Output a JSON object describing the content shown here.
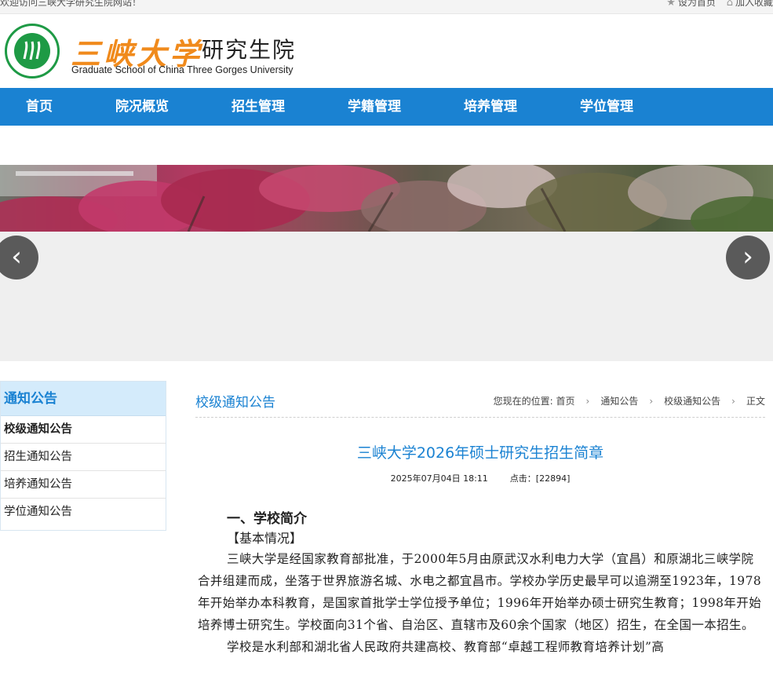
{
  "topbar": {
    "welcome": "欢迎访问三峡大学研究生院网站！",
    "set_home": "设为首页",
    "add_favorite": "加入收藏"
  },
  "header": {
    "brand_cn": "三峡大学",
    "school_cn": "研究生院",
    "school_en": "Graduate School of China Three Gorges University"
  },
  "nav": {
    "items": [
      {
        "label": "首页"
      },
      {
        "label": "院况概览"
      },
      {
        "label": "招生管理"
      },
      {
        "label": "学籍管理"
      },
      {
        "label": "培养管理"
      },
      {
        "label": "学位管理"
      }
    ]
  },
  "banner": {
    "prev": "‹",
    "next": "›"
  },
  "sidebar": {
    "title": "通知公告",
    "items": [
      {
        "label": "校级通知公告"
      },
      {
        "label": "招生通知公告"
      },
      {
        "label": "培养通知公告"
      },
      {
        "label": "学位通知公告"
      }
    ]
  },
  "main": {
    "section_title": "校级通知公告",
    "breadcrumb": {
      "prefix": "您现在的位置:",
      "items": [
        "首页",
        "通知公告",
        "校级通知公告",
        "正文"
      ],
      "separator": "›"
    }
  },
  "article": {
    "title": "三峡大学2026年硕士研究生招生简章",
    "date": "2025年07月04日 18:11",
    "clicks": "点击：[22894]",
    "h1": "一、学校简介",
    "h2": "【基本情况】",
    "p1": "三峡大学是经国家教育部批准，于2000年5月由原武汉水利电力大学（宜昌）和原湖北三峡学院合并组建而成，坐落于世界旅游名城、水电之都宜昌市。学校办学历史最早可以追溯至1923年，1978年开始举办本科教育，是国家首批学士学位授予单位；1996年开始举办硕士研究生教育；1998年开始培养博士研究生。学校面向31个省、自治区、直辖市及60余个国家（地区）招生，在全国一本招生。",
    "p2": "学校是水利部和湖北省人民政府共建高校、教育部“卓越工程师教育培养计划”高"
  },
  "colors": {
    "nav_blue": "#1a82d2",
    "brand_orange": "#f08a1c",
    "seal_green": "#1e9a45"
  }
}
